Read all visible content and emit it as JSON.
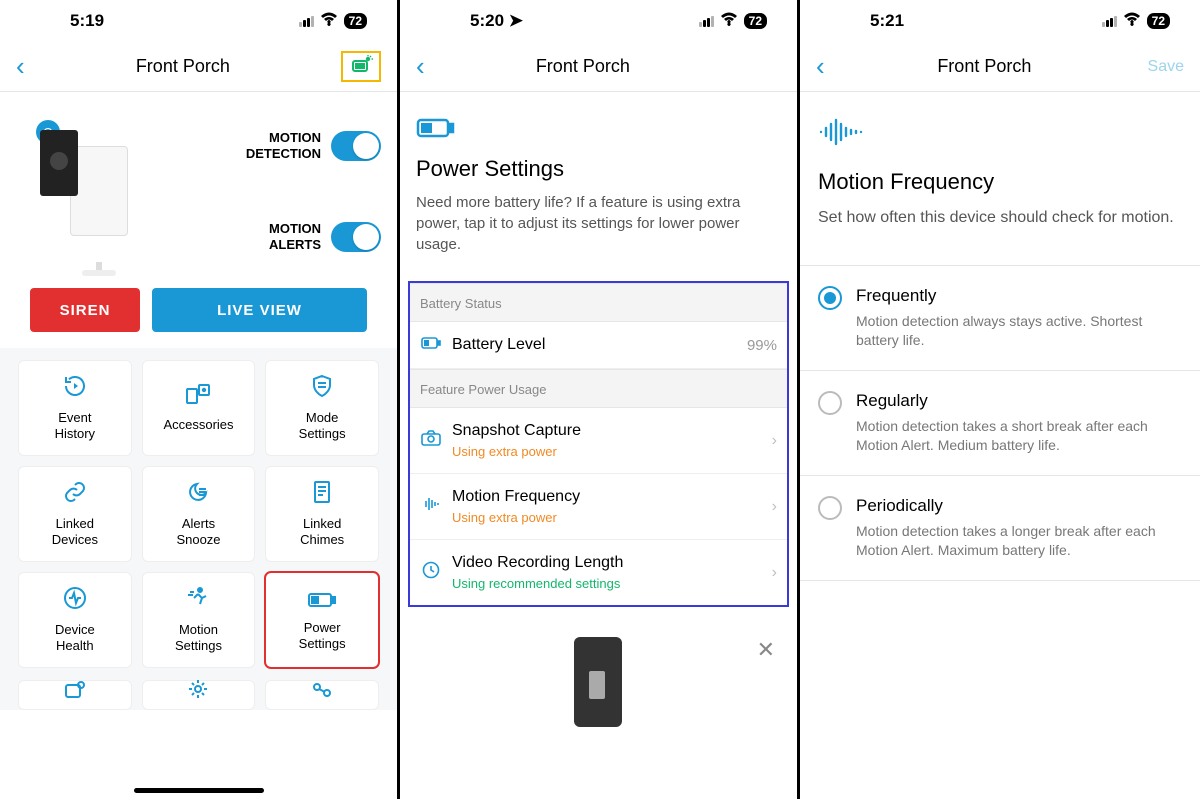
{
  "status": {
    "times": [
      "5:19",
      "5:20",
      "5:21"
    ],
    "location_arrow": true,
    "battery_badge": "72"
  },
  "nav": {
    "title": "Front Porch",
    "save": "Save"
  },
  "panel1": {
    "toggle1_l1": "MOTION",
    "toggle1_l2": "DETECTION",
    "toggle2_l1": "MOTION",
    "toggle2_l2": "ALERTS",
    "siren": "SIREN",
    "live_view": "LIVE VIEW",
    "tiles": [
      {
        "icon": "↻",
        "label_l1": "Event",
        "label_l2": "History"
      },
      {
        "icon": "⎘",
        "label_l1": "Accessories",
        "label_l2": ""
      },
      {
        "icon": "🛡",
        "label_l1": "Mode",
        "label_l2": "Settings"
      },
      {
        "icon": "🔗",
        "label_l1": "Linked",
        "label_l2": "Devices"
      },
      {
        "icon": "☾≡",
        "label_l1": "Alerts",
        "label_l2": "Snooze"
      },
      {
        "icon": "🗎",
        "label_l1": "Linked",
        "label_l2": "Chimes"
      },
      {
        "icon": "⊕",
        "label_l1": "Device",
        "label_l2": "Health"
      },
      {
        "icon": "🏃",
        "label_l1": "Motion",
        "label_l2": "Settings"
      },
      {
        "icon": "🔋",
        "label_l1": "Power",
        "label_l2": "Settings"
      }
    ]
  },
  "panel2": {
    "title": "Power Settings",
    "subtitle": "Need more battery life? If a feature is using extra power, tap it to adjust its settings for lower power usage.",
    "sec1": "Battery Status",
    "battery_row": {
      "label": "Battery Level",
      "value": "99%"
    },
    "sec2": "Feature Power Usage",
    "rows": [
      {
        "icon": "📷",
        "title": "Snapshot Capture",
        "sub": "Using extra power",
        "sub_class": "orange"
      },
      {
        "icon": "╋",
        "title": "Motion Frequency",
        "sub": "Using extra power",
        "sub_class": "orange"
      },
      {
        "icon": "◴",
        "title": "Video Recording Length",
        "sub": "Using recommended settings",
        "sub_class": "green"
      }
    ]
  },
  "panel3": {
    "title": "Motion Frequency",
    "subtitle": "Set how often this device should check for motion.",
    "options": [
      {
        "title": "Frequently",
        "desc": "Motion detection always stays active. Shortest battery life.",
        "selected": true
      },
      {
        "title": "Regularly",
        "desc": "Motion detection takes a short break after each Motion Alert. Medium battery life.",
        "selected": false
      },
      {
        "title": "Periodically",
        "desc": "Motion detection takes a longer break after each Motion Alert. Maximum battery life.",
        "selected": false
      }
    ]
  }
}
